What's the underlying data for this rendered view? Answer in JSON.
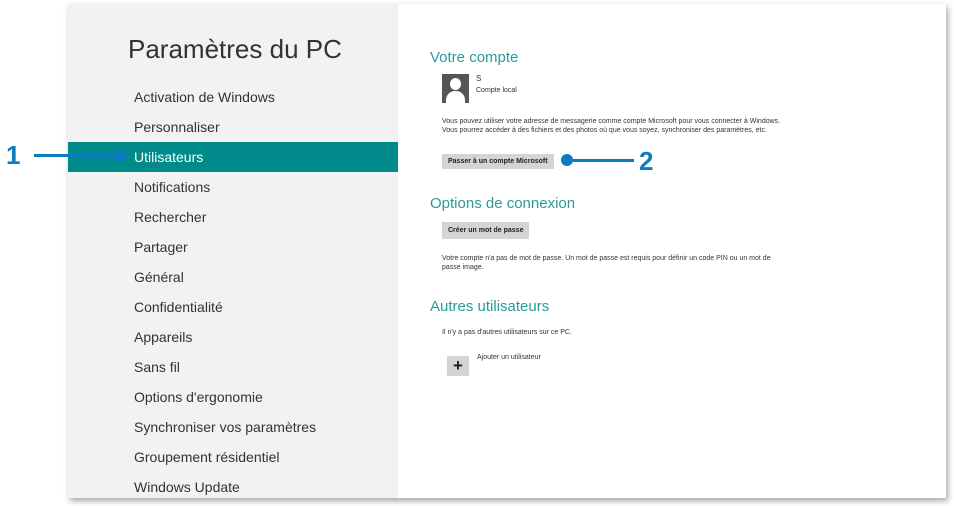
{
  "sidebar": {
    "title": "Paramètres du PC",
    "items": [
      {
        "label": "Activation de Windows"
      },
      {
        "label": "Personnaliser"
      },
      {
        "label": "Utilisateurs",
        "selected": true
      },
      {
        "label": "Notifications"
      },
      {
        "label": "Rechercher"
      },
      {
        "label": "Partager"
      },
      {
        "label": "Général"
      },
      {
        "label": "Confidentialité"
      },
      {
        "label": "Appareils"
      },
      {
        "label": "Sans fil"
      },
      {
        "label": "Options d'ergonomie"
      },
      {
        "label": "Synchroniser vos paramètres"
      },
      {
        "label": "Groupement résidentiel"
      },
      {
        "label": "Windows Update"
      }
    ]
  },
  "account": {
    "heading": "Votre compte",
    "user_name": "S",
    "user_type": "Compte local",
    "description": "Vous pouvez utiliser votre adresse de messagerie comme compte Microsoft pour vous connecter à Windows. Vous pourrez accéder à des fichiers et des photos où que vous soyez, synchroniser des paramètres, etc.",
    "switch_button": "Passer à un compte Microsoft"
  },
  "signin": {
    "heading": "Options de connexion",
    "create_password_button": "Créer un mot de passe",
    "description": "Votre compte n'a pas de mot de passe. Un mot de passe est requis pour définir un code PIN ou un mot de passe image."
  },
  "others": {
    "heading": "Autres utilisateurs",
    "description": "Il n'y a pas d'autres utilisateurs sur ce PC.",
    "add_user": "Ajouter un utilisateur"
  },
  "callouts": {
    "one": "1",
    "two": "2"
  },
  "colors": {
    "accent": "#008a8a",
    "callout": "#0c7bc0"
  }
}
